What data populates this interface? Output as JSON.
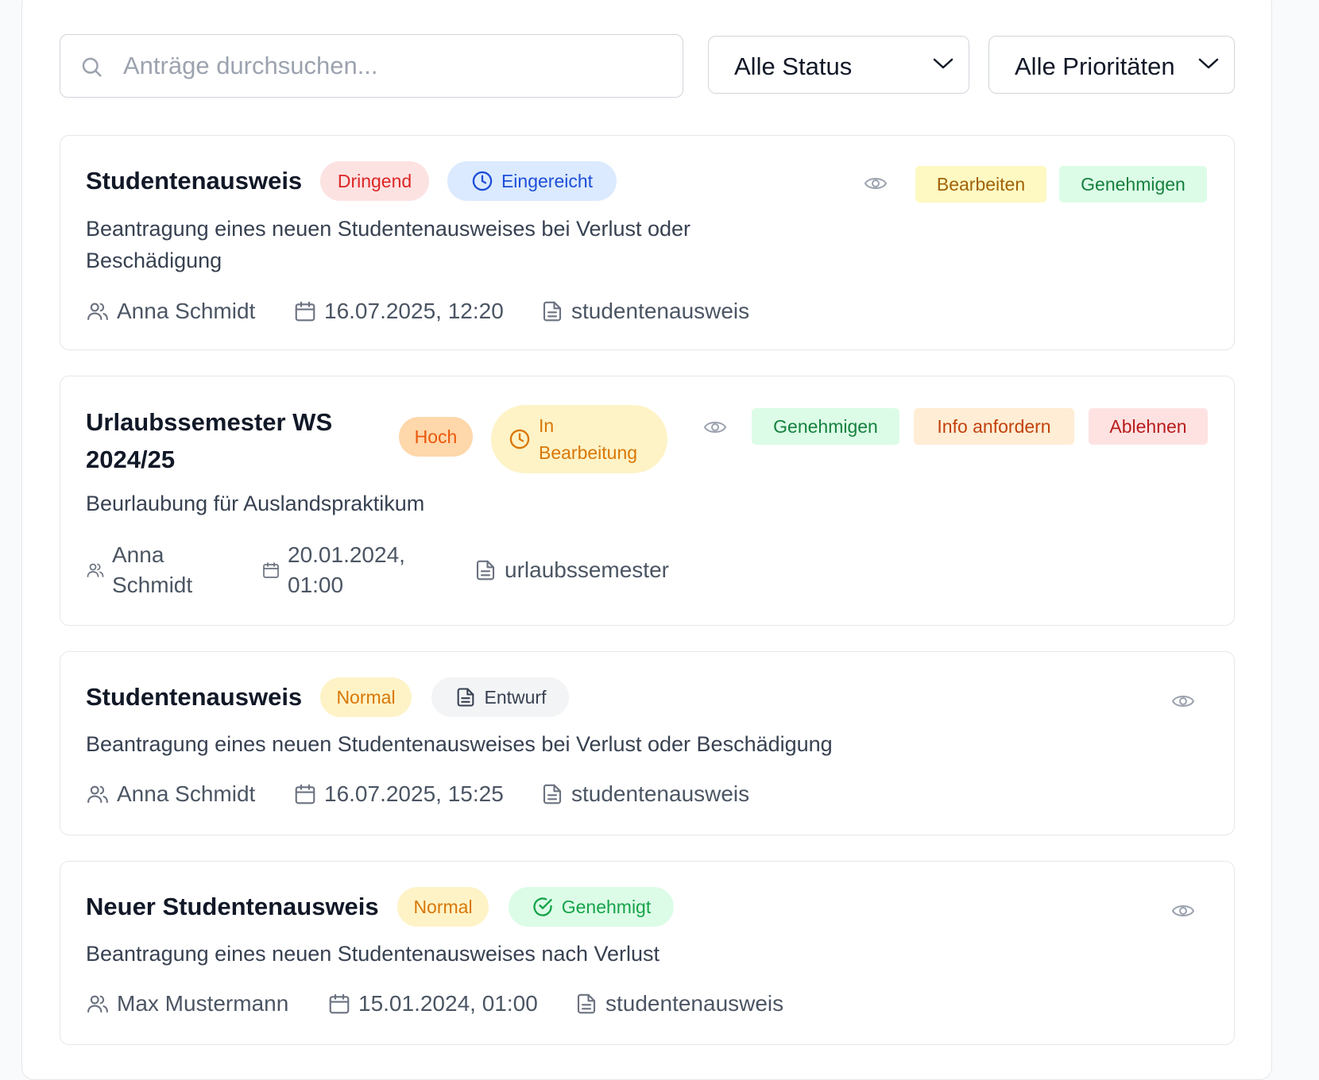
{
  "toolbar": {
    "search_placeholder": "Anträge durchsuchen...",
    "status_filter": "Alle Status",
    "priority_filter": "Alle Prioritäten"
  },
  "colors": {
    "dringend": "#dc2626",
    "hoch": "#ea580c",
    "normal": "#d97706",
    "eingereicht": "#1d4ed8",
    "in_bearbeitung": "#d97706",
    "entwurf": "#374151",
    "genehmigt": "#16a34a"
  },
  "requests": [
    {
      "title": "Studentenausweis",
      "priority": "Dringend",
      "status": "Eingereicht",
      "status_icon": "clock-icon",
      "description": "Beantragung eines neuen Studentenausweises bei Verlust oder Beschädigung",
      "user": "Anna Schmidt",
      "date": "16.07.2025, 12:20",
      "type": "studentenausweis",
      "actions": [
        "Bearbeiten",
        "Genehmigen"
      ]
    },
    {
      "title": "Urlaubssemester WS 2024/25",
      "priority": "Hoch",
      "status": "In Bearbeitung",
      "status_icon": "clock-icon",
      "description": "Beurlaubung für Auslandspraktikum",
      "user": "Anna Schmidt",
      "date": "20.01.2024, 01:00",
      "type": "urlaubssemester",
      "actions": [
        "Genehmigen",
        "Info anfordern",
        "Ablehnen"
      ]
    },
    {
      "title": "Studentenausweis",
      "priority": "Normal",
      "status": "Entwurf",
      "status_icon": "document-icon",
      "description": "Beantragung eines neuen Studentenausweises bei Verlust oder Beschädigung",
      "user": "Anna Schmidt",
      "date": "16.07.2025, 15:25",
      "type": "studentenausweis",
      "actions": []
    },
    {
      "title": "Neuer Studentenausweis",
      "priority": "Normal",
      "status": "Genehmigt",
      "status_icon": "check-circle-icon",
      "description": "Beantragung eines neuen Studentenausweises nach Verlust",
      "user": "Max Mustermann",
      "date": "15.01.2024, 01:00",
      "type": "studentenausweis",
      "actions": []
    }
  ]
}
